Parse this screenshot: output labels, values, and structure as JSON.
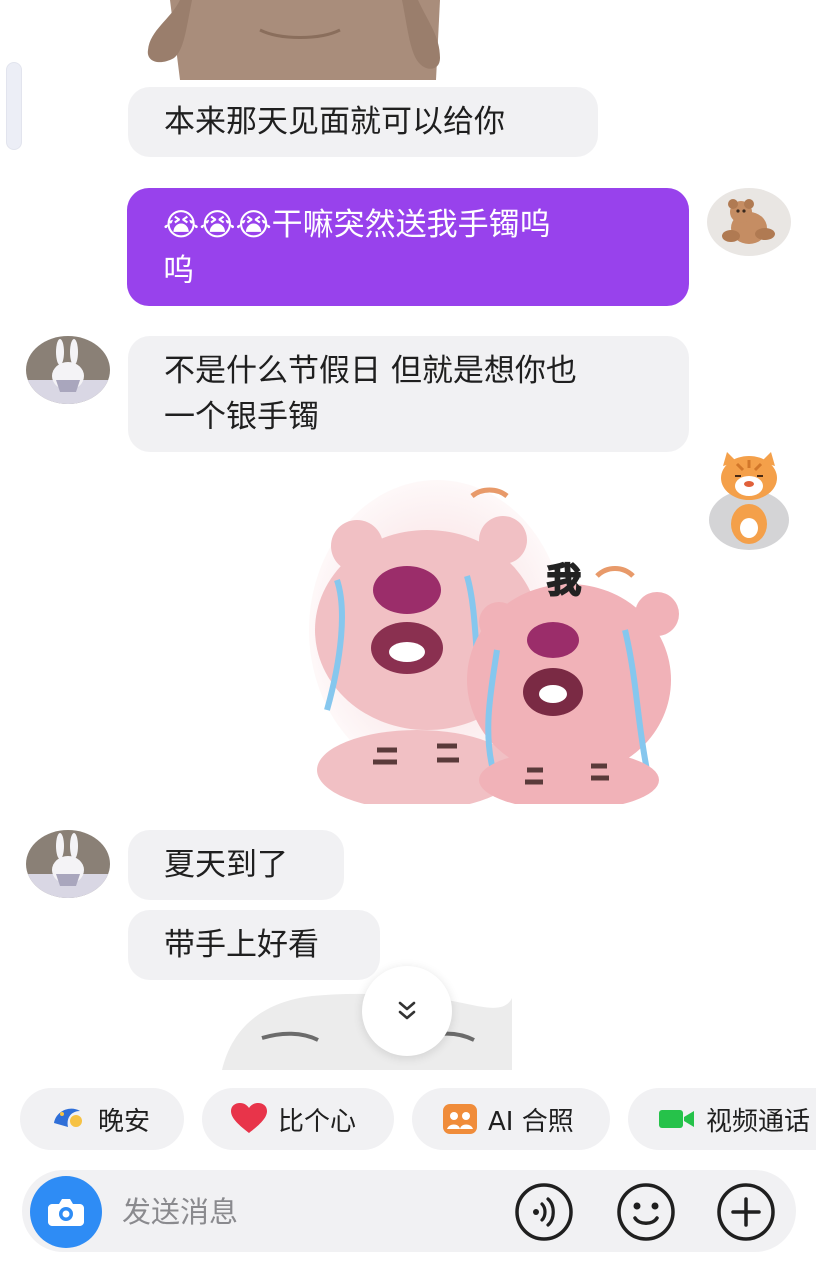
{
  "colors": {
    "outgoing_bubble": "#9842ec",
    "incoming_bubble": "#f1f1f3",
    "camera_button": "#2e8cf5",
    "chip_background": "#f1f1f3"
  },
  "messages": [
    {
      "id": "m1",
      "direction": "incoming",
      "type": "text",
      "text": "本来那天见面就可以给你"
    },
    {
      "id": "m2",
      "direction": "outgoing",
      "type": "text",
      "emoji": "😭😭😭",
      "text_line1": "干嘛突然送我手镯呜",
      "text_line2": "呜"
    },
    {
      "id": "m3",
      "direction": "incoming",
      "type": "text",
      "text_line1": "不是什么节假日 但就是想你也",
      "text_line2": "一个银手镯"
    },
    {
      "id": "m4",
      "direction": "outgoing",
      "type": "sticker",
      "sticker_caption": "我",
      "icon": "crying-pink-bear-sticker"
    },
    {
      "id": "m5",
      "direction": "incoming",
      "type": "text",
      "text": "夏天到了"
    },
    {
      "id": "m6",
      "direction": "incoming",
      "type": "text",
      "text": "带手上好看"
    },
    {
      "id": "m7",
      "direction": "incoming",
      "type": "sticker",
      "icon": "white-cat-sticker"
    }
  ],
  "avatars": {
    "self_1": "teddy-bear-avatar",
    "self_2": "orange-cat-avatar",
    "partner": "bunny-plush-avatar"
  },
  "quick_actions": [
    {
      "label": "晚安",
      "icon": "moon-icon"
    },
    {
      "label": "比个心",
      "icon": "heart-icon"
    },
    {
      "label": "AI 合照",
      "icon": "ai-photo-icon"
    },
    {
      "label": "视频通话",
      "icon": "video-camera-icon"
    }
  ],
  "composer": {
    "placeholder": "发送消息",
    "value": "",
    "camera_icon": "camera-icon",
    "voice_icon": "voice-icon",
    "emoji_icon": "smiley-icon",
    "plus_icon": "plus-icon"
  },
  "scroll_down_icon": "chevron-double-down-icon"
}
